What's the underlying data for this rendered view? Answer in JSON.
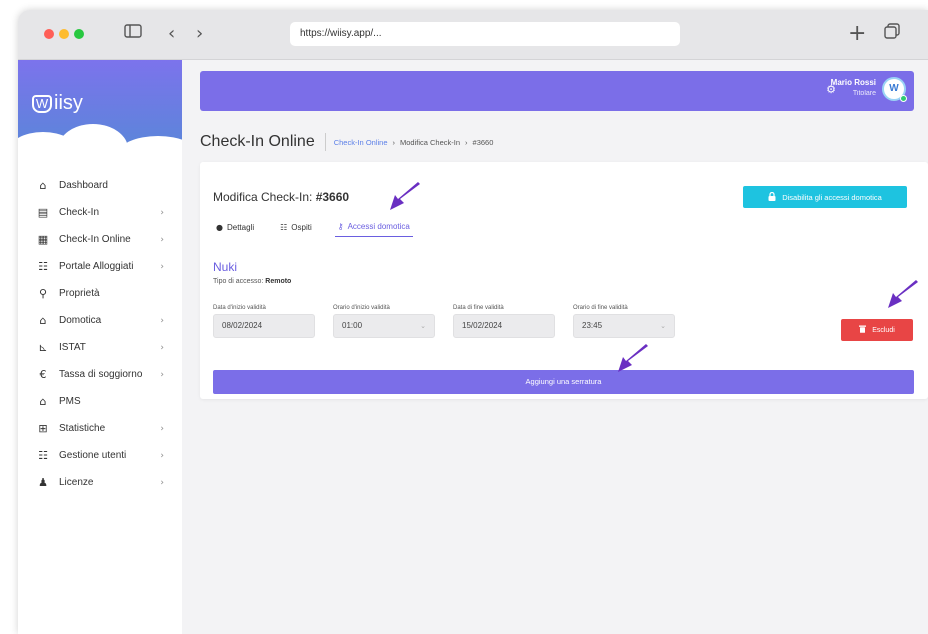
{
  "browser": {
    "url": "https://wiisy.app/...",
    "traffic_colors": [
      "#ff5f57",
      "#febc2e",
      "#28c840"
    ],
    "icons": [
      "sidebar-toggle-icon",
      "back-icon",
      "forward-icon",
      "new-tab-icon",
      "tabs-icon"
    ]
  },
  "sidebar": {
    "logo": "iisy",
    "logo_mark": "W",
    "items": [
      {
        "label": "Dashboard",
        "icon": "home-icon",
        "glyph": "⌂",
        "chevron": false
      },
      {
        "label": "Check-In",
        "icon": "clipboard-icon",
        "glyph": "▤",
        "chevron": true
      },
      {
        "label": "Check-In Online",
        "icon": "calendar-check-icon",
        "glyph": "▦",
        "chevron": true
      },
      {
        "label": "Portale Alloggiati",
        "icon": "users-cog-icon",
        "glyph": "☷",
        "chevron": true
      },
      {
        "label": "Proprietà",
        "icon": "map-marker-icon",
        "glyph": "⚲",
        "chevron": false
      },
      {
        "label": "Domotica",
        "icon": "smart-home-icon",
        "glyph": "⌂",
        "chevron": true
      },
      {
        "label": "ISTAT",
        "icon": "chart-icon",
        "glyph": "⊾",
        "chevron": true
      },
      {
        "label": "Tassa di soggiorno",
        "icon": "euro-icon",
        "glyph": "€",
        "chevron": true
      },
      {
        "label": "PMS",
        "icon": "building-icon",
        "glyph": "⌂",
        "chevron": false
      },
      {
        "label": "Statistiche",
        "icon": "table-icon",
        "glyph": "⊞",
        "chevron": true
      },
      {
        "label": "Gestione utenti",
        "icon": "users-icon",
        "glyph": "☷",
        "chevron": true
      },
      {
        "label": "Licenze",
        "icon": "user-license-icon",
        "glyph": "♟",
        "chevron": true
      }
    ]
  },
  "topbar": {
    "user_name": "Mario Rossi",
    "user_role": "Titolare",
    "avatar_letter": "W",
    "accent": "#7b6ee8"
  },
  "page": {
    "title": "Check-In Online",
    "breadcrumb": [
      "Check-In Online",
      "Modifica Check-In",
      "#3660"
    ]
  },
  "card": {
    "title_prefix": "Modifica Check-In: ",
    "title_id": "#3660",
    "disable_button": "Disabilita gli accessi domotica",
    "tabs": [
      {
        "label": "Dettagli",
        "glyph": "●",
        "active": false
      },
      {
        "label": "Ospiti",
        "glyph": "☷",
        "active": false
      },
      {
        "label": "Accessi domotica",
        "glyph": "⚷",
        "active": true
      }
    ],
    "device_name": "Nuki",
    "access_type_label": "Tipo di accesso: ",
    "access_type_value": "Remoto",
    "fields": [
      {
        "label": "Data d'inizio validità",
        "value": "08/02/2024",
        "dropdown": false
      },
      {
        "label": "Orario d'inizio validità",
        "value": "01:00",
        "dropdown": true
      },
      {
        "label": "Data di fine validità",
        "value": "15/02/2024",
        "dropdown": false
      },
      {
        "label": "Orario di fine validità",
        "value": "23:45",
        "dropdown": true
      }
    ],
    "exclude_button": "Escludi",
    "add_lock_button": "Aggiungi una serratura"
  },
  "colors": {
    "primary": "#7b6ee8",
    "cyan": "#1ec3e0",
    "danger": "#e84545",
    "annotation_arrow": "#6a2fc2"
  }
}
